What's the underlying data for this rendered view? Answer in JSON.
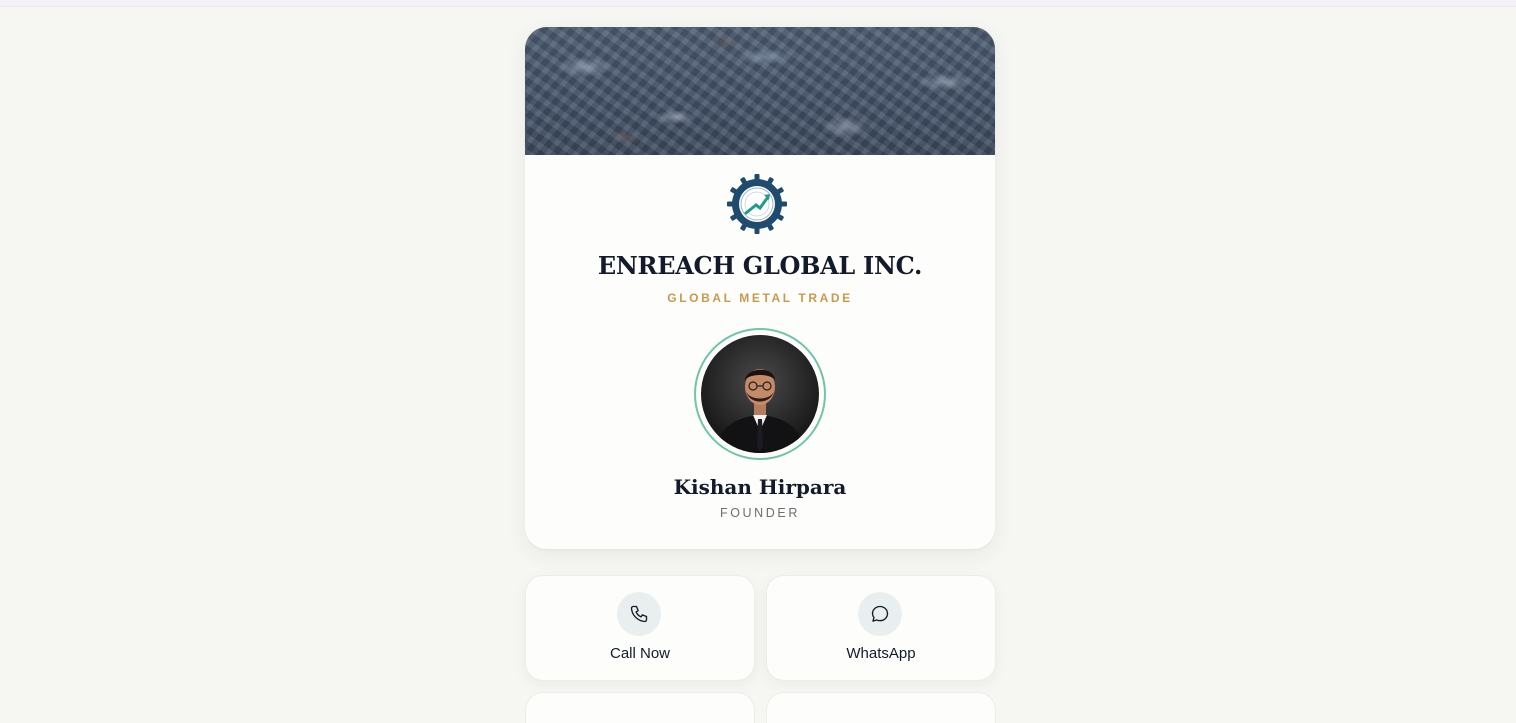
{
  "profile": {
    "company": "ENREACH GLOBAL INC.",
    "tagline": "GLOBAL METAL TRADE",
    "name": "Kishan Hirpara",
    "role": "FOUNDER"
  },
  "actions": [
    {
      "label": "Call Now",
      "icon": "phone-icon"
    },
    {
      "label": "WhatsApp",
      "icon": "chat-bubble-icon"
    }
  ],
  "colors": {
    "background": "#f6f6f2",
    "heading": "#121a2b",
    "tagline": "#c79a4e",
    "avatar_ring": "#6fc5a8",
    "logo_gear": "#1f4b6e",
    "icon_circle": "#e8efee"
  }
}
